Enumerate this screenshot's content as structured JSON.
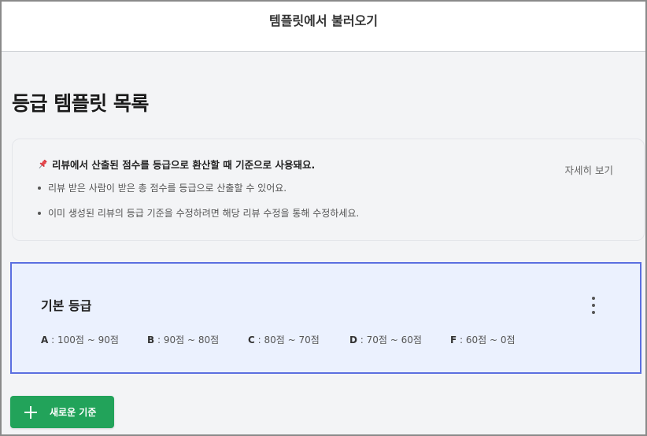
{
  "header": {
    "title": "템플릿에서 불러오기"
  },
  "page": {
    "title": "등급 템플릿 목록"
  },
  "info": {
    "headline": "리뷰에서 산출된 점수를 등급으로 환산할 때 기준으로 사용돼요.",
    "bullets": [
      "리뷰 받은 사람이 받은 총 점수를 등급으로 산출할 수 있어요.",
      "이미 생성된 리뷰의 등급 기준을 수정하려면 해당 리뷰 수정을 통해 수정하세요."
    ],
    "detail_link": "자세히 보기",
    "pin_icon": "pushpin-icon"
  },
  "template_card": {
    "title": "기본 등급",
    "menu_icon": "more-vertical-icon",
    "grades": [
      {
        "letter": "A",
        "range": " : 100점 ~ 90점"
      },
      {
        "letter": "B",
        "range": " : 90점 ~ 80점"
      },
      {
        "letter": "C",
        "range": " : 80점 ~ 70점"
      },
      {
        "letter": "D",
        "range": " : 70점 ~ 60점"
      },
      {
        "letter": "F",
        "range": " : 60점 ~ 0점"
      }
    ]
  },
  "new_button": {
    "label": "새로운 기준",
    "icon": "plus-icon"
  },
  "colors": {
    "accent_green": "#22a35a",
    "card_border": "#5b6fe0",
    "card_bg": "#ebf1fe",
    "page_bg": "#f3f4f6"
  }
}
